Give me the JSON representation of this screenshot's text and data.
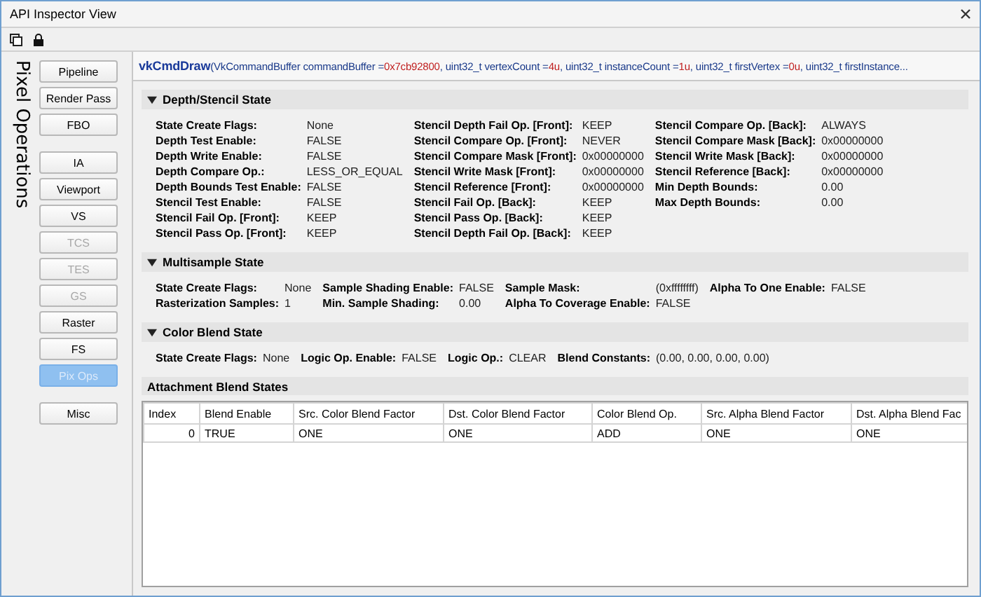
{
  "window": {
    "title": "API Inspector View"
  },
  "sidebar": {
    "title": "Pixel Operations",
    "groups": [
      [
        {
          "label": "Pipeline",
          "disabled": false,
          "selected": false
        },
        {
          "label": "Render Pass",
          "disabled": false,
          "selected": false
        },
        {
          "label": "FBO",
          "disabled": false,
          "selected": false
        }
      ],
      [
        {
          "label": "IA",
          "disabled": false,
          "selected": false
        },
        {
          "label": "Viewport",
          "disabled": false,
          "selected": false
        },
        {
          "label": "VS",
          "disabled": false,
          "selected": false
        },
        {
          "label": "TCS",
          "disabled": true,
          "selected": false
        },
        {
          "label": "TES",
          "disabled": true,
          "selected": false
        },
        {
          "label": "GS",
          "disabled": true,
          "selected": false
        },
        {
          "label": "Raster",
          "disabled": false,
          "selected": false
        },
        {
          "label": "FS",
          "disabled": false,
          "selected": false
        },
        {
          "label": "Pix Ops",
          "disabled": false,
          "selected": true
        }
      ],
      [
        {
          "label": "Misc",
          "disabled": false,
          "selected": false
        }
      ]
    ]
  },
  "call": [
    {
      "kind": "name",
      "text": "vkCmdDraw"
    },
    {
      "kind": "plain",
      "text": "(VkCommandBuffer commandBuffer = "
    },
    {
      "kind": "value",
      "text": "0x7cb92800"
    },
    {
      "kind": "plain",
      "text": ", uint32_t vertexCount = "
    },
    {
      "kind": "value",
      "text": "4u"
    },
    {
      "kind": "plain",
      "text": ", uint32_t instanceCount = "
    },
    {
      "kind": "value",
      "text": "1u"
    },
    {
      "kind": "plain",
      "text": ", uint32_t firstVertex = "
    },
    {
      "kind": "value",
      "text": "0u"
    },
    {
      "kind": "plain",
      "text": ", uint32_t firstInstance..."
    }
  ],
  "sections": [
    {
      "title": "Depth/Stencil State",
      "expanded": true,
      "columns": [
        [
          {
            "label": "State Create Flags:",
            "value": "None"
          },
          {
            "label": "Depth Test Enable:",
            "value": "FALSE"
          },
          {
            "label": "Depth Write Enable:",
            "value": "FALSE"
          },
          {
            "label": "Depth Compare Op.:",
            "value": "LESS_OR_EQUAL"
          },
          {
            "label": "Depth Bounds Test Enable:",
            "value": "FALSE"
          },
          {
            "label": "Stencil Test Enable:",
            "value": "FALSE"
          },
          {
            "label": "Stencil Fail Op. [Front]:",
            "value": "KEEP"
          },
          {
            "label": "Stencil Pass Op. [Front]:",
            "value": "KEEP"
          }
        ],
        [
          {
            "label": "Stencil Depth Fail Op. [Front]:",
            "value": "KEEP"
          },
          {
            "label": "Stencil Compare Op. [Front]:",
            "value": "NEVER"
          },
          {
            "label": "Stencil Compare Mask [Front]:",
            "value": "0x00000000"
          },
          {
            "label": "Stencil Write Mask [Front]:",
            "value": "0x00000000"
          },
          {
            "label": "Stencil Reference [Front]:",
            "value": "0x00000000"
          },
          {
            "label": "Stencil Fail Op. [Back]:",
            "value": "KEEP"
          },
          {
            "label": "Stencil Pass Op. [Back]:",
            "value": "KEEP"
          },
          {
            "label": "Stencil Depth Fail Op. [Back]:",
            "value": "KEEP"
          }
        ],
        [
          {
            "label": "Stencil Compare Op. [Back]:",
            "value": "ALWAYS"
          },
          {
            "label": "Stencil Compare Mask [Back]:",
            "value": "0x00000000"
          },
          {
            "label": "Stencil Write Mask [Back]:",
            "value": "0x00000000"
          },
          {
            "label": "Stencil Reference [Back]:",
            "value": "0x00000000"
          },
          {
            "label": "Min Depth Bounds:",
            "value": "0.00"
          },
          {
            "label": "Max Depth Bounds:",
            "value": "0.00"
          }
        ]
      ]
    },
    {
      "title": "Multisample State",
      "expanded": true,
      "columns": [
        [
          {
            "label": "State Create Flags:",
            "value": "None"
          },
          {
            "label": "Rasterization Samples:",
            "value": "1"
          }
        ],
        [
          {
            "label": "Sample Shading Enable:",
            "value": "FALSE"
          },
          {
            "label": "Min. Sample Shading:",
            "value": "0.00"
          }
        ],
        [
          {
            "label": "Sample Mask:",
            "value": "(0xffffffff)"
          },
          {
            "label": "Alpha To Coverage Enable:",
            "value": "FALSE"
          }
        ],
        [
          {
            "label": "Alpha To One Enable:",
            "value": "FALSE"
          }
        ]
      ]
    },
    {
      "title": "Color Blend State",
      "expanded": true,
      "columns": [
        [
          {
            "label": "State Create Flags:",
            "value": "None"
          }
        ],
        [
          {
            "label": "Logic Op. Enable:",
            "value": "FALSE"
          }
        ],
        [
          {
            "label": "Logic Op.:",
            "value": "CLEAR"
          }
        ],
        [
          {
            "label": "Blend Constants:",
            "value": "(0.00, 0.00, 0.00, 0.00)"
          }
        ]
      ]
    }
  ],
  "attachments": {
    "title": "Attachment Blend States",
    "columns": [
      "Index",
      "Blend Enable",
      "Src. Color Blend Factor",
      "Dst. Color Blend Factor",
      "Color Blend Op.",
      "Src. Alpha Blend Factor",
      "Dst. Alpha Blend Fac"
    ],
    "rows": [
      [
        "0",
        "TRUE",
        "ONE",
        "ONE",
        "ADD",
        "ONE",
        "ONE"
      ]
    ]
  }
}
